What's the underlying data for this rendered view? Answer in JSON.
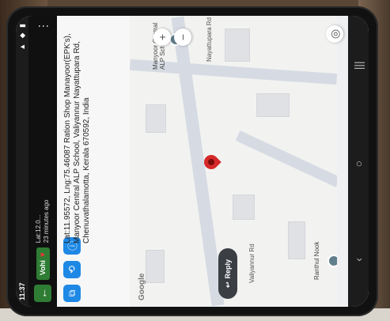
{
  "status": {
    "time": "11:37",
    "icons_text": "▲ ◆ ▮"
  },
  "camera": {
    "back_icon": "back-arrow-icon",
    "app_badge": "Vohi",
    "heart_icon": "heart-icon",
    "line1": "Lat:12.0...",
    "line2": "23 minutes ago"
  },
  "stamp": {
    "text": "Lat:11.95572, Lng:75.46087 Ration Shop Manayoor(EPK's), Manyoor Central ALP School, Valiyannur Nayattupara Rd, Chenuvathalamotta, Kerala 670592, India"
  },
  "map": {
    "poi_school": "Manyoor Central ALP School",
    "poi_bottom": "Ranthul Nook",
    "road_label": "Nayattupara Rd",
    "road_label_bottom": "Valiyannur Rd",
    "google_logo": "Google",
    "zoom_in": "+",
    "zoom_out": "−",
    "reply_label": "Reply"
  },
  "navbar": {
    "back": "‹",
    "home": "○",
    "recents": "|||"
  }
}
